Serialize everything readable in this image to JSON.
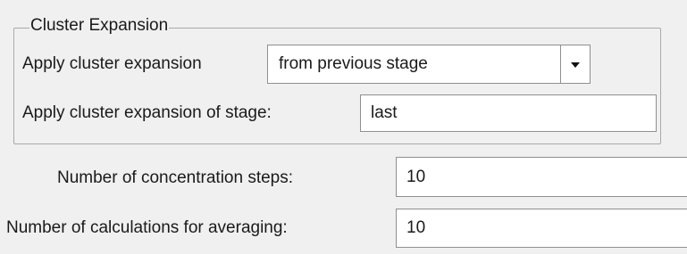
{
  "cluster_expansion": {
    "group_title": "Cluster Expansion",
    "apply_label": "Apply cluster expansion",
    "apply_value": "from previous stage",
    "stage_label": "Apply cluster expansion of stage:",
    "stage_value": "last"
  },
  "concentration_steps": {
    "label": "Number of concentration steps:",
    "value": "10"
  },
  "averaging": {
    "label": "Number of calculations for averaging:",
    "value": "10"
  },
  "icons": {
    "dropdown": "chevron-down-icon"
  }
}
